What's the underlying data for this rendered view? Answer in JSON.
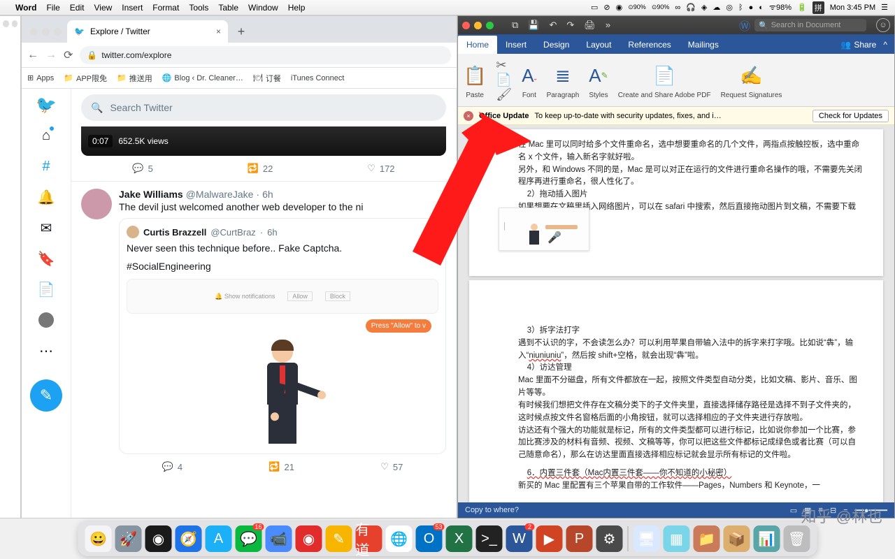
{
  "menubar": {
    "app": "Word",
    "items": [
      "File",
      "Edit",
      "View",
      "Insert",
      "Format",
      "Tools",
      "Table",
      "Window",
      "Help"
    ],
    "mem1": {
      "label": "MEM",
      "value": "90%"
    },
    "mem2": {
      "label": "MEM",
      "value": "90%"
    },
    "wifi_pct": "98%",
    "ime": "拼",
    "clock": "Mon 3:45 PM"
  },
  "chrome": {
    "tab_title": "Explore / Twitter",
    "url": "twitter.com/explore",
    "bookmarks": [
      "Apps",
      "APP限免",
      "推送用",
      "Blog ‹ Dr. Cleaner…",
      "订餐",
      "iTunes Connect"
    ]
  },
  "twitter": {
    "search_placeholder": "Search Twitter",
    "video": {
      "time": "0:07",
      "views": "652.5K views"
    },
    "actions1": {
      "reply": "5",
      "rt": "22",
      "like": "172"
    },
    "tweet": {
      "name": "Jake Williams",
      "handle": "@MalwareJake",
      "time": "6h",
      "body": "The devil just welcomed another web developer to the ni"
    },
    "quote": {
      "name": "Curtis Brazzell",
      "handle": "@CurtBraz",
      "time": "6h",
      "line1": "Never seen this technique before.. Fake Captcha.",
      "line2": "#SocialEngineering",
      "img_caption": "Show notifications",
      "allow": "Allow",
      "block": "Block",
      "bubble": "Press \"Allow\" to v"
    },
    "actions2": {
      "reply": "4",
      "rt": "21",
      "like": "57"
    }
  },
  "word": {
    "search_placeholder": "Search in Document",
    "tabs": [
      "Home",
      "Insert",
      "Design",
      "Layout",
      "References",
      "Mailings"
    ],
    "share": "Share",
    "ribbon": {
      "paste": "Paste",
      "font": "Font",
      "paragraph": "Paragraph",
      "styles": "Styles",
      "pdf": "Create and Share Adobe PDF",
      "sig": "Request Signatures"
    },
    "notice": {
      "title": "Office Update",
      "msg": "To keep up-to-date with security updates, fixes, and i…",
      "btn": "Check for Updates"
    },
    "page1": {
      "l1": "在 Mac 里可以同时给多个文件重命名，选中想要重命名的几个文件，两指点按触控板，选中重命名 x 个文件，输入新名字就好啦。",
      "l2": "另外，和 Windows 不同的是，Mac 是可以对正在运行的文件进行重命名操作的哦，不需要先关闭程序再进行重命名，很人性化了。",
      "l3": "2）拖动插入图片",
      "l4": "如果想要在文稿里插入网络图片，可以在 safari 中搜索，然后直接拖动图片到文稿，不需要下载再插入等等操作。"
    },
    "page2": {
      "l1": "3）拆字法打字",
      "l2a": "遇到不认识的字，不会读怎么办？可以利用苹果自带输入法中的拆字来打字哦。比如说“犇”，输入“",
      "l2b": "niuniuniu",
      "l2c": "”，然后按 shift+空格，就会出现“犇”啦。",
      "l3": "4）访达管理",
      "l4": "Mac 里面不分磁盘，所有文件都放在一起，按照文件类型自动分类，比如文稿、影片、音乐、图片等等。",
      "l5": "有时候我们想把文件存在文稿分类下的子文件夹里，直接选择储存路径是选择不到子文件夹的，这时候点按文件名窗格后面的小角按钮，就可以选择相应的子文件夹进行存放啦。",
      "l6": "访达还有个强大的功能就是标记，所有的文件类型都可以进行标记，比如说你参加一个比赛，参加比赛涉及的材料有音频、视频、文稿等等，你可以把这些文件都标记成绿色或者比赛（可以自己随意命名），那么在访达里面直接选择相应标记就会显示所有标记的文件啦。",
      "l7": "6．内置三件套（Mac内置三件套——你不知道的小秘密）",
      "l8": "新买的 Mac 里配置有三个苹果自带的工作软件——Pages，Numbers 和 Keynote，一"
    },
    "status": "Copy to where?"
  },
  "dock": {
    "items": [
      {
        "bg": "#f4f4f6",
        "glyph": "😀"
      },
      {
        "bg": "#8795a3",
        "glyph": "🚀"
      },
      {
        "bg": "#1a1a1a",
        "glyph": "◉"
      },
      {
        "bg": "#1e73e8",
        "glyph": "🧭"
      },
      {
        "bg": "#1cb0f6",
        "glyph": "A"
      },
      {
        "bg": "#09b83e",
        "glyph": "💬",
        "badge": "16"
      },
      {
        "bg": "#4a8cff",
        "glyph": "📹"
      },
      {
        "bg": "#e22b2b",
        "glyph": "◉"
      },
      {
        "bg": "#f7b500",
        "glyph": "✎"
      },
      {
        "bg": "#e6412d",
        "glyph": "有道"
      },
      {
        "bg": "#fff",
        "glyph": "🌐"
      },
      {
        "bg": "#0072c6",
        "glyph": "O",
        "badge": "53"
      },
      {
        "bg": "#217346",
        "glyph": "X"
      },
      {
        "bg": "#222",
        "glyph": ">_"
      },
      {
        "bg": "#2b579a",
        "glyph": "W",
        "badge": "2"
      },
      {
        "bg": "#d04423",
        "glyph": "▶"
      },
      {
        "bg": "#b7472a",
        "glyph": "P"
      },
      {
        "bg": "#4a4a4a",
        "glyph": "⚙"
      }
    ],
    "recent": [
      {
        "bg": "#d9e7ff",
        "glyph": "🖥"
      },
      {
        "bg": "#7bd5e8",
        "glyph": "▦"
      },
      {
        "bg": "#c97b5a",
        "glyph": "📁"
      },
      {
        "bg": "#dcaf6e",
        "glyph": "📦"
      },
      {
        "bg": "#5aa6a6",
        "glyph": "📊"
      },
      {
        "bg": "#bdbdbd",
        "glyph": "🗑"
      }
    ]
  },
  "watermark": "知乎 @林也"
}
